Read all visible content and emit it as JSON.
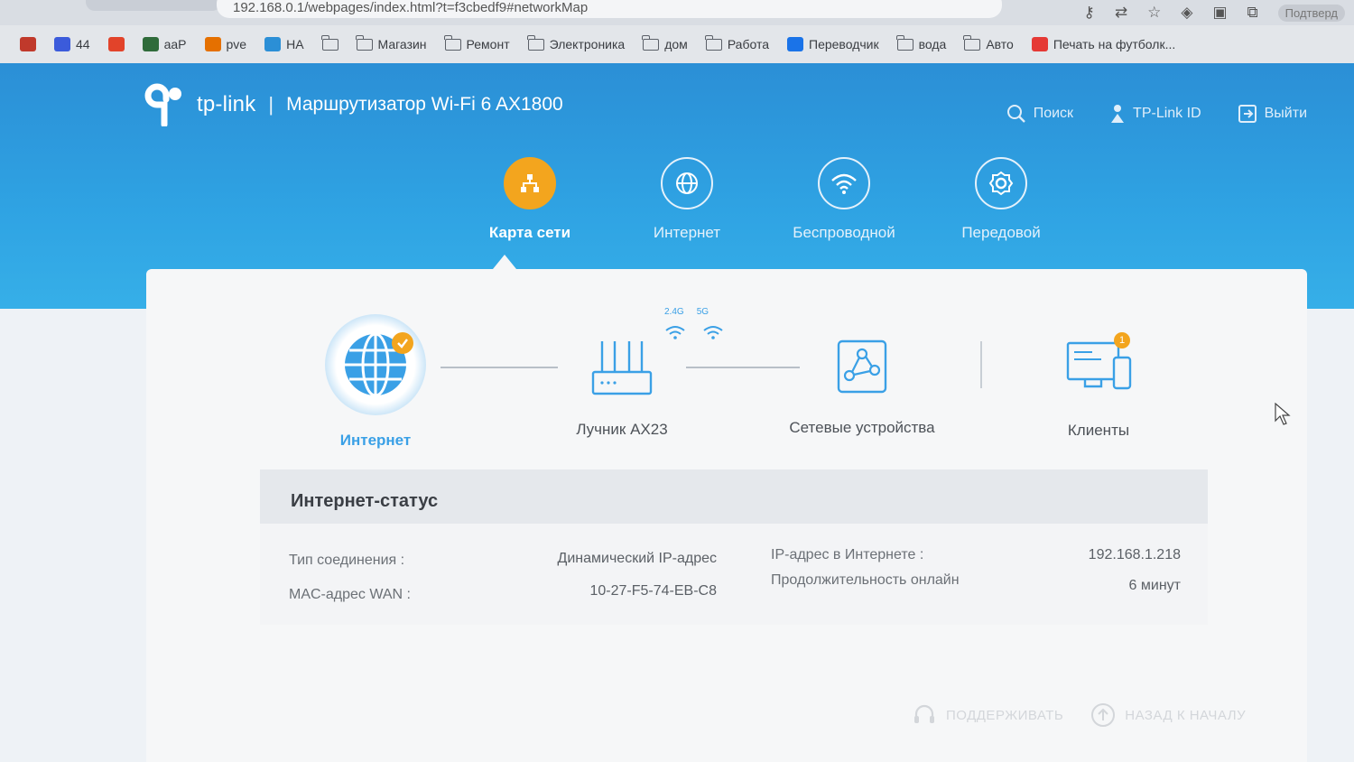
{
  "browser": {
    "url": "192.168.0.1/webpages/index.html?t=f3cbedf9#networkMap",
    "profile_label": "Подтверд"
  },
  "bookmarks": [
    {
      "label": "",
      "icon": "opera-icon",
      "color": "#c0392b"
    },
    {
      "label": "44",
      "icon": "app-icon",
      "color": "#3b5bdb"
    },
    {
      "label": "",
      "icon": "gitlab-icon",
      "color": "#e2432a"
    },
    {
      "label": "aaP",
      "icon": "aa-icon",
      "color": "#2f6b3a"
    },
    {
      "label": "pve",
      "icon": "proxmox-icon",
      "color": "#e57000"
    },
    {
      "label": "HA",
      "icon": "home-assistant-icon",
      "color": "#2b8fd6"
    },
    {
      "label": "",
      "icon": "folder-icon",
      "folder": true
    },
    {
      "label": "Магазин",
      "icon": "folder-icon",
      "folder": true
    },
    {
      "label": "Ремонт",
      "icon": "folder-icon",
      "folder": true
    },
    {
      "label": "Электроника",
      "icon": "folder-icon",
      "folder": true
    },
    {
      "label": "дом",
      "icon": "folder-icon",
      "folder": true
    },
    {
      "label": "Работа",
      "icon": "folder-icon",
      "folder": true
    },
    {
      "label": "Переводчик",
      "icon": "translate-icon",
      "color": "#1a73e8"
    },
    {
      "label": "вода",
      "icon": "folder-icon",
      "folder": true
    },
    {
      "label": "Авто",
      "icon": "folder-icon",
      "folder": true
    },
    {
      "label": "Печать на футболк...",
      "icon": "s-icon",
      "color": "#e53935"
    }
  ],
  "header": {
    "brand": "tp-link",
    "separator": "|",
    "model": "Маршрутизатор Wi-Fi 6 AX1800",
    "search": "Поиск",
    "tplink_id": "TP-Link ID",
    "logout": "Выйти"
  },
  "nav": [
    {
      "label": "Карта сети",
      "active": true
    },
    {
      "label": "Интернет",
      "active": false
    },
    {
      "label": "Беспроводной",
      "active": false
    },
    {
      "label": "Передовой",
      "active": false
    }
  ],
  "topology": {
    "internet": "Интернет",
    "router": "Лучник AX23",
    "band_24": "2.4G",
    "band_5": "5G",
    "network_devices": "Сетевые устройства",
    "clients": "Клиенты",
    "clients_count": "1"
  },
  "status": {
    "title": "Интернет-статус",
    "connection_type_label": "Тип соединения :",
    "connection_type_value": "Динамический IP-адрес",
    "mac_label": "MAC-адрес WAN :",
    "mac_value": "10-27-F5-74-EB-C8",
    "ip_label": "IP-адрес в Интернете :",
    "ip_value": "192.168.1.218",
    "uptime_label": "Продолжительность онлайн",
    "uptime_value": "6 минут"
  },
  "footer": {
    "support": "ПОДДЕРЖИВАТЬ",
    "back_to_top": "НАЗАД К НАЧАЛУ"
  },
  "colors": {
    "brand_blue": "#2fa3e3",
    "accent_orange": "#f3a51e",
    "link_blue": "#3aa0e6"
  }
}
